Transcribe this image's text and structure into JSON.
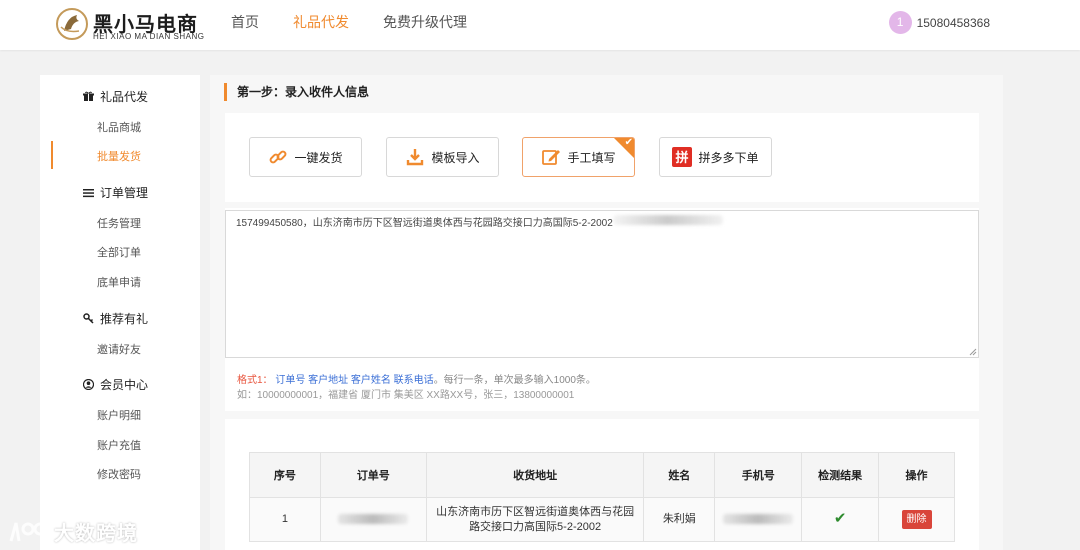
{
  "header": {
    "logo_cn": "黑小马电商",
    "logo_en": "HEI XIAO MA DIAN SHANG",
    "nav": [
      {
        "label": "首页",
        "active": false
      },
      {
        "label": "礼品代发",
        "active": true
      },
      {
        "label": "免费升级代理",
        "active": false
      }
    ],
    "user_badge": "1",
    "user_phone": "15080458368"
  },
  "sidebar": {
    "groups": [
      {
        "title": "礼品代发",
        "icon": "gift-icon",
        "items": [
          {
            "label": "礼品商城",
            "active": false
          },
          {
            "label": "批量发货",
            "active": true
          }
        ]
      },
      {
        "title": "订单管理",
        "icon": "list-icon",
        "items": [
          {
            "label": "任务管理",
            "active": false
          },
          {
            "label": "全部订单",
            "active": false
          },
          {
            "label": "底单申请",
            "active": false
          }
        ]
      },
      {
        "title": "推荐有礼",
        "icon": "key-icon",
        "items": [
          {
            "label": "邀请好友",
            "active": false
          }
        ]
      },
      {
        "title": "会员中心",
        "icon": "user-icon",
        "items": [
          {
            "label": "账户明细",
            "active": false
          },
          {
            "label": "账户充值",
            "active": false
          },
          {
            "label": "修改密码",
            "active": false
          }
        ]
      }
    ]
  },
  "main": {
    "step_title": "第一步：录入收件人信息",
    "buttons": [
      {
        "label": "一键发货",
        "icon": "link-icon",
        "selected": false
      },
      {
        "label": "模板导入",
        "icon": "download-icon",
        "selected": false
      },
      {
        "label": "手工填写",
        "icon": "edit-icon",
        "selected": true
      },
      {
        "label": "拼多多下单",
        "icon": "pinduoduo-icon",
        "selected": false
      }
    ],
    "input_text": "157499450580，山东济南市历下区智远街道奥体西与花园路交接口力高国际5-2-2002",
    "hint_label": "格式1：",
    "hint_fields": "订单号 客户地址 客户姓名 联系电话",
    "hint_rest": "。每行一条，单次最多输入1000条。",
    "hint_example": "如：10000000001，福建省 厦门市 集美区 XX路XX号，张三，13800000001"
  },
  "table": {
    "headers": [
      "序号",
      "订单号",
      "收货地址",
      "姓名",
      "手机号",
      "检测结果",
      "操作"
    ],
    "rows": [
      {
        "index": "1",
        "order_no": "",
        "address": "山东济南市历下区智远街道奥体西与花园路交接口力高国际5-2-2002",
        "name": "朱利娟",
        "phone": "",
        "check": "✔",
        "action": "删除"
      }
    ]
  },
  "watermark": {
    "text": "大数跨境"
  },
  "colors": {
    "accent": "#f08a2e",
    "danger": "#d9453a",
    "success": "#2e8b2e",
    "link": "#3b6fd6"
  }
}
